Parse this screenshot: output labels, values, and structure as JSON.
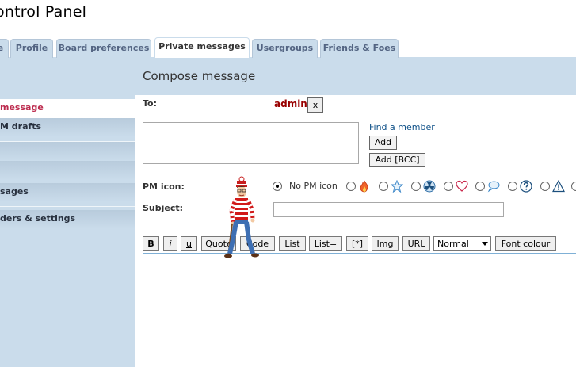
{
  "page": {
    "title": "ontrol Panel"
  },
  "tabs": [
    {
      "label": "e"
    },
    {
      "label": "Profile"
    },
    {
      "label": "Board preferences"
    },
    {
      "label": "Private messages",
      "active": true
    },
    {
      "label": "Usergroups"
    },
    {
      "label": "Friends & Foes"
    }
  ],
  "sidebar": {
    "items": [
      {
        "label": "message",
        "current": true
      },
      {
        "label": "M drafts"
      },
      {
        "label": ""
      },
      {
        "label": ""
      },
      {
        "label": "sages"
      },
      {
        "label": "ders & settings"
      }
    ]
  },
  "compose": {
    "title": "Compose message",
    "to_label": "To:",
    "recipient": "admin",
    "remove_label": "x",
    "to_value": "",
    "find_member": "Find a member",
    "add_label": "Add",
    "add_bcc_label": "Add [BCC]",
    "pm_icon_label": "PM icon:",
    "no_icon_label": "No PM icon",
    "pm_icons": [
      "fire-icon",
      "star-icon",
      "radioactive-icon",
      "heart-icon",
      "speech-bubble-icon",
      "question-icon",
      "warning-icon"
    ],
    "subject_label": "Subject:",
    "subject_value": "",
    "message_value": ""
  },
  "toolbar": {
    "bold": "B",
    "italic": "i",
    "underline": "u",
    "quote": "Quote",
    "code": "Code",
    "list": "List",
    "list_eq": "List=",
    "list_item": "[*]",
    "img": "Img",
    "url": "URL",
    "font_size": "Normal",
    "font_colour": "Font colour"
  },
  "colors": {
    "tab_bg": "#cadceb",
    "tab_text": "#536482",
    "current_item": "#bc2a4d",
    "recipient": "#990000",
    "link": "#105289"
  }
}
